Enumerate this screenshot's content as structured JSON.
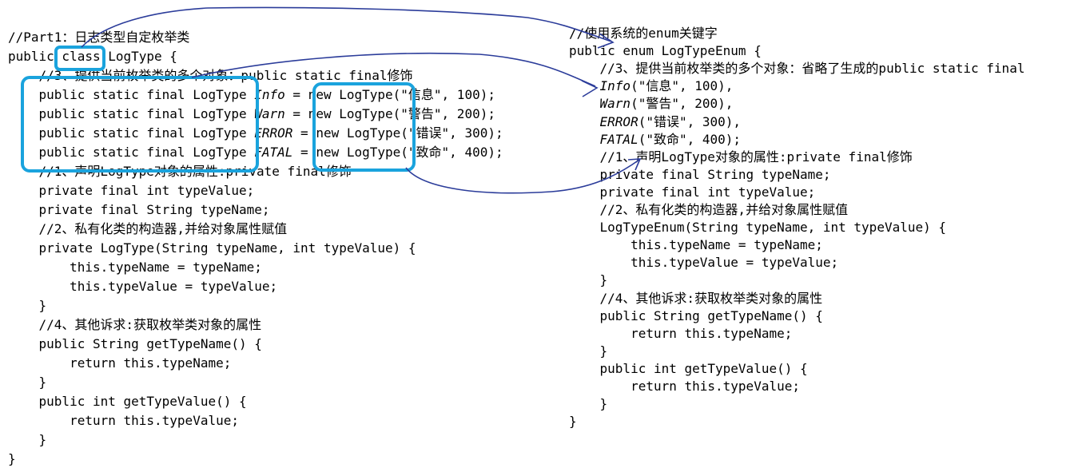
{
  "left_code": {
    "lines": [
      [
        {
          "t": "//Part1：日志类型自定枚举类"
        }
      ],
      [
        {
          "t": "public class LogType {"
        }
      ],
      [
        {
          "t": "    //3、提供当前枚举类的多个对象：public static final修饰"
        }
      ],
      [
        {
          "t": "    public static final LogType "
        },
        {
          "t": "Info",
          "i": true
        },
        {
          "t": " = new LogType(\"信息\", 100);"
        }
      ],
      [
        {
          "t": "    public static final LogType "
        },
        {
          "t": "Warn",
          "i": true
        },
        {
          "t": " = new LogType(\"警告\", 200);"
        }
      ],
      [
        {
          "t": "    public static final LogType "
        },
        {
          "t": "ERROR",
          "i": true
        },
        {
          "t": " = new LogType(\"错误\", 300);"
        }
      ],
      [
        {
          "t": "    public static final LogType "
        },
        {
          "t": "FATAL",
          "i": true
        },
        {
          "t": " = new LogType(\"致命\", 400);"
        }
      ],
      [
        {
          "t": "    //1、声明LogType对象的属性:private final修饰"
        }
      ],
      [
        {
          "t": "    private final int typeValue;"
        }
      ],
      [
        {
          "t": "    private final String typeName;"
        }
      ],
      [
        {
          "t": "    //2、私有化类的构造器,并给对象属性赋值"
        }
      ],
      [
        {
          "t": "    private LogType(String typeName, int typeValue) {"
        }
      ],
      [
        {
          "t": "        this.typeName = typeName;"
        }
      ],
      [
        {
          "t": "        this.typeValue = typeValue;"
        }
      ],
      [
        {
          "t": "    }"
        }
      ],
      [
        {
          "t": "    //4、其他诉求:获取枚举类对象的属性"
        }
      ],
      [
        {
          "t": "    public String getTypeName() {"
        }
      ],
      [
        {
          "t": "        return this.typeName;"
        }
      ],
      [
        {
          "t": "    }"
        }
      ],
      [
        {
          "t": "    public int getTypeValue() {"
        }
      ],
      [
        {
          "t": "        return this.typeValue;"
        }
      ],
      [
        {
          "t": "    }"
        }
      ],
      [
        {
          "t": "}"
        }
      ]
    ]
  },
  "right_code": {
    "lines": [
      [
        {
          "t": "//使用系统的enum关键字"
        }
      ],
      [
        {
          "t": "public enum LogTypeEnum {"
        }
      ],
      [
        {
          "t": "    //3、提供当前枚举类的多个对象：省略了生成的public static final"
        }
      ],
      [
        {
          "t": "    "
        },
        {
          "t": "Info",
          "i": true
        },
        {
          "t": "(\"信息\", 100),"
        }
      ],
      [
        {
          "t": "    "
        },
        {
          "t": "Warn",
          "i": true
        },
        {
          "t": "(\"警告\", 200),"
        }
      ],
      [
        {
          "t": "    "
        },
        {
          "t": "ERROR",
          "i": true
        },
        {
          "t": "(\"错误\", 300),"
        }
      ],
      [
        {
          "t": "    "
        },
        {
          "t": "FATAL",
          "i": true
        },
        {
          "t": "(\"致命\", 400);"
        }
      ],
      [
        {
          "t": "    //1、声明LogType对象的属性:private final修饰"
        }
      ],
      [
        {
          "t": "    private final String typeName;"
        }
      ],
      [
        {
          "t": "    private final int typeValue;"
        }
      ],
      [
        {
          "t": "    //2、私有化类的构造器,并给对象属性赋值"
        }
      ],
      [
        {
          "t": "    LogTypeEnum(String typeName, int typeValue) {"
        }
      ],
      [
        {
          "t": "        this.typeName = typeName;"
        }
      ],
      [
        {
          "t": "        this.typeValue = typeValue;"
        }
      ],
      [
        {
          "t": "    }"
        }
      ],
      [
        {
          "t": "    //4、其他诉求:获取枚举类对象的属性"
        }
      ],
      [
        {
          "t": "    public String getTypeName() {"
        }
      ],
      [
        {
          "t": "        return this.typeName;"
        }
      ],
      [
        {
          "t": "    }"
        }
      ],
      [
        {
          "t": "    public int getTypeValue() {"
        }
      ],
      [
        {
          "t": "        return this.typeValue;"
        }
      ],
      [
        {
          "t": "    }"
        }
      ],
      [
        {
          "t": "}"
        }
      ]
    ]
  },
  "colors": {
    "highlight_box": "#1aa3dd",
    "pen_stroke": "#2b3c9a",
    "text": "#000000",
    "background": "#ffffff"
  }
}
